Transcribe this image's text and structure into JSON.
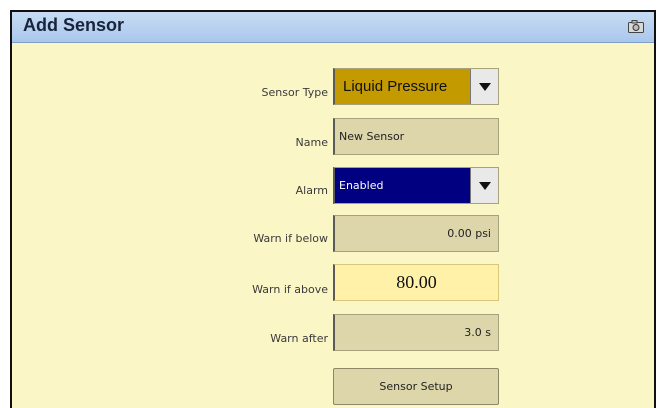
{
  "dialog": {
    "title": "Add Sensor",
    "camera_icon": "camera-icon"
  },
  "form": {
    "sensor_type": {
      "label": "Sensor Type",
      "value": "Liquid Pressure"
    },
    "name": {
      "label": "Name",
      "value": "New Sensor"
    },
    "alarm": {
      "label": "Alarm",
      "value": "Enabled"
    },
    "warn_below": {
      "label": "Warn if below",
      "value": "0.00 psi"
    },
    "warn_above": {
      "label": "Warn if above",
      "value": "80.00"
    },
    "warn_after": {
      "label": "Warn after",
      "value": "3.0 s"
    },
    "setup_button": "Sensor Setup"
  },
  "colors": {
    "background": "#fbf6c6",
    "sensor_type_bg": "#c39a00",
    "alarm_bg": "#000080",
    "active_field_bg": "#fff2a8"
  }
}
